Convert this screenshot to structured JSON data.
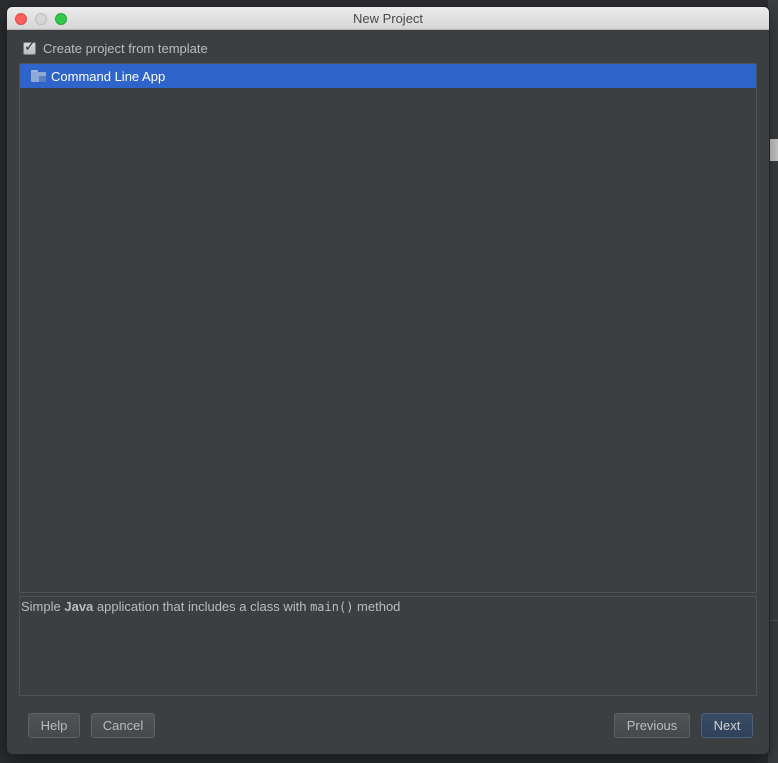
{
  "window": {
    "title": "New Project"
  },
  "template_checkbox": {
    "label": "Create project from template",
    "checked": true
  },
  "templates": {
    "items": [
      {
        "label": "Command Line App",
        "icon": "folder-icon",
        "selected": true
      }
    ]
  },
  "description": {
    "prefix": "Simple ",
    "language": "Java",
    "middle": " application that includes a class with ",
    "method": "main()",
    "suffix": " method"
  },
  "buttons": {
    "help": "Help",
    "cancel": "Cancel",
    "previous": "Previous",
    "next": "Next"
  },
  "colors": {
    "selection": "#2f65ca",
    "dialog_bg": "#3c3f41",
    "text": "#bbbbbb"
  }
}
